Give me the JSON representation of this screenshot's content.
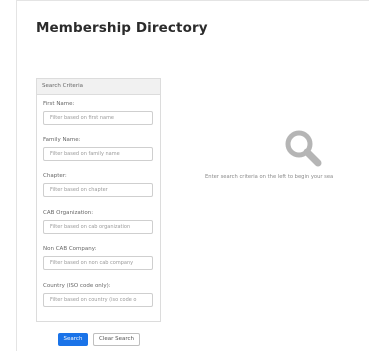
{
  "page": {
    "title": "Membership Directory"
  },
  "criteria": {
    "header": "Search Criteria",
    "fields": [
      {
        "label": "First Name:",
        "placeholder": "Filter based on first name"
      },
      {
        "label": "Family Name:",
        "placeholder": "Filter based on family name"
      },
      {
        "label": "Chapter:",
        "placeholder": "Filter based on chapter"
      },
      {
        "label": "CAB Organization:",
        "placeholder": "Filter based on cab organization"
      },
      {
        "label": "Non CAB Company:",
        "placeholder": "Filter based on non cab company"
      },
      {
        "label": "Country (ISO code only):",
        "placeholder": "Filter based on country (iso code o"
      }
    ]
  },
  "actions": {
    "search_label": "Search",
    "clear_label": "Clear Search"
  },
  "empty_state": {
    "icon": "search-icon",
    "message": "Enter search criteria on the left to begin your sea"
  },
  "colors": {
    "primary": "#1a73e8",
    "icon_gray": "#b5b5b5"
  }
}
